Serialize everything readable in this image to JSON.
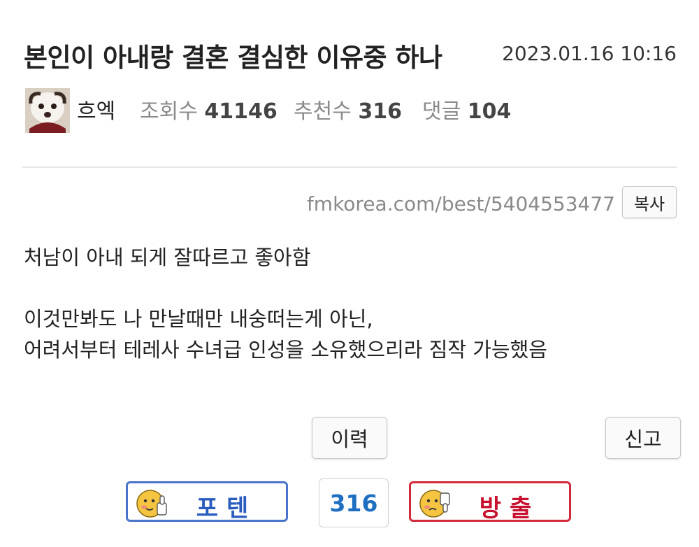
{
  "post": {
    "title": "본인이 아내랑 결혼 결심한 이유중 하나",
    "date": "2023.01.16 10:16",
    "author": "흐엑",
    "views_label": "조회수",
    "views": "41146",
    "recommend_label": "추천수",
    "recommend": "316",
    "comments_label": "댓글",
    "comments": "104",
    "url": "fmkorea.com/best/5404553477",
    "copy_label": "복사",
    "body": {
      "line1": "처남이 아내 되게 잘따르고 좋아함",
      "line2": "이것만봐도 나 만날때만 내숭떠는게 아닌,",
      "line3": "어려서부터 테레사 수녀급 인성을 소유했으리라 짐작 가능했음"
    }
  },
  "actions": {
    "history_label": "이력",
    "report_label": "신고",
    "upvote_label": "포텐",
    "vote_count": "316",
    "downvote_label": "방출"
  },
  "colors": {
    "upvote_border": "#4a74c9",
    "upvote_text": "#2b5dbf",
    "downvote_border": "#d12b3b",
    "downvote_text": "#c8102e",
    "count_text": "#1f6fc1"
  }
}
